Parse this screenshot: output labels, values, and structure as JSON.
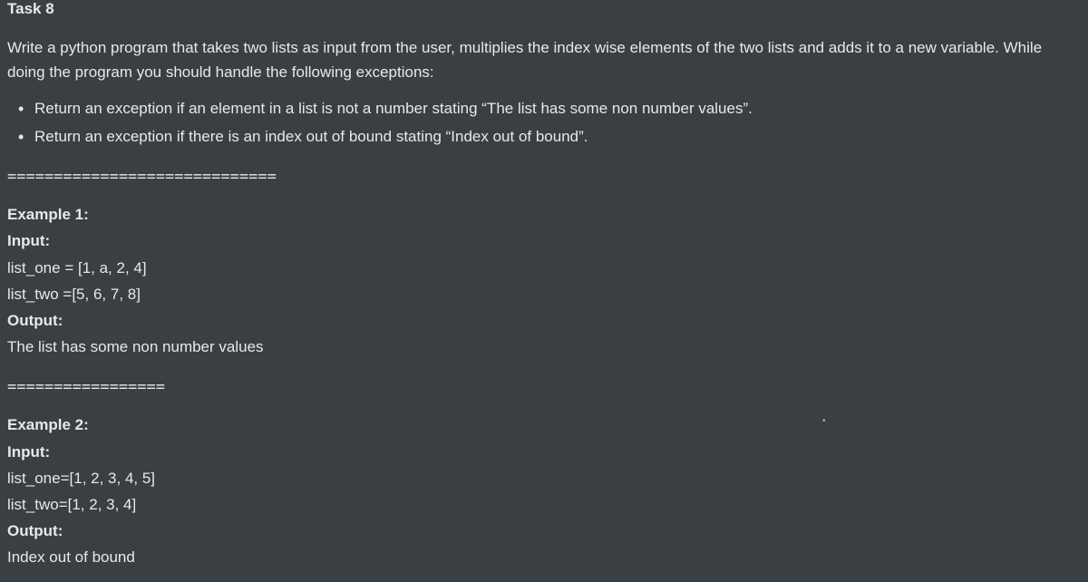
{
  "taskHeader": "Task 8",
  "description": "Write a python program that takes two lists as input from the user, multiplies the index wise elements of the two lists and adds it to a new variable. While doing the program you should handle the following exceptions:",
  "bullets": [
    "Return an exception if an element in a list is not a number stating “The list has some non number values”.",
    "Return an exception if there is an index out of bound stating “Index out of bound”."
  ],
  "separator1": "=============================",
  "example1": {
    "title": "Example 1:",
    "inputLabel": "Input:",
    "listOne": "list_one = [1, a, 2, 4]",
    "listTwo": "list_two =[5, 6, 7, 8]",
    "outputLabel": "Output:",
    "outputValue": "The list has some non number values"
  },
  "separator2": "=================",
  "example2": {
    "title": "Example 2:",
    "inputLabel": "Input:",
    "listOne": "list_one=[1, 2, 3, 4, 5]",
    "listTwo": "list_two=[1, 2, 3, 4]",
    "outputLabel": "Output:",
    "outputValue": "Index out of bound"
  }
}
